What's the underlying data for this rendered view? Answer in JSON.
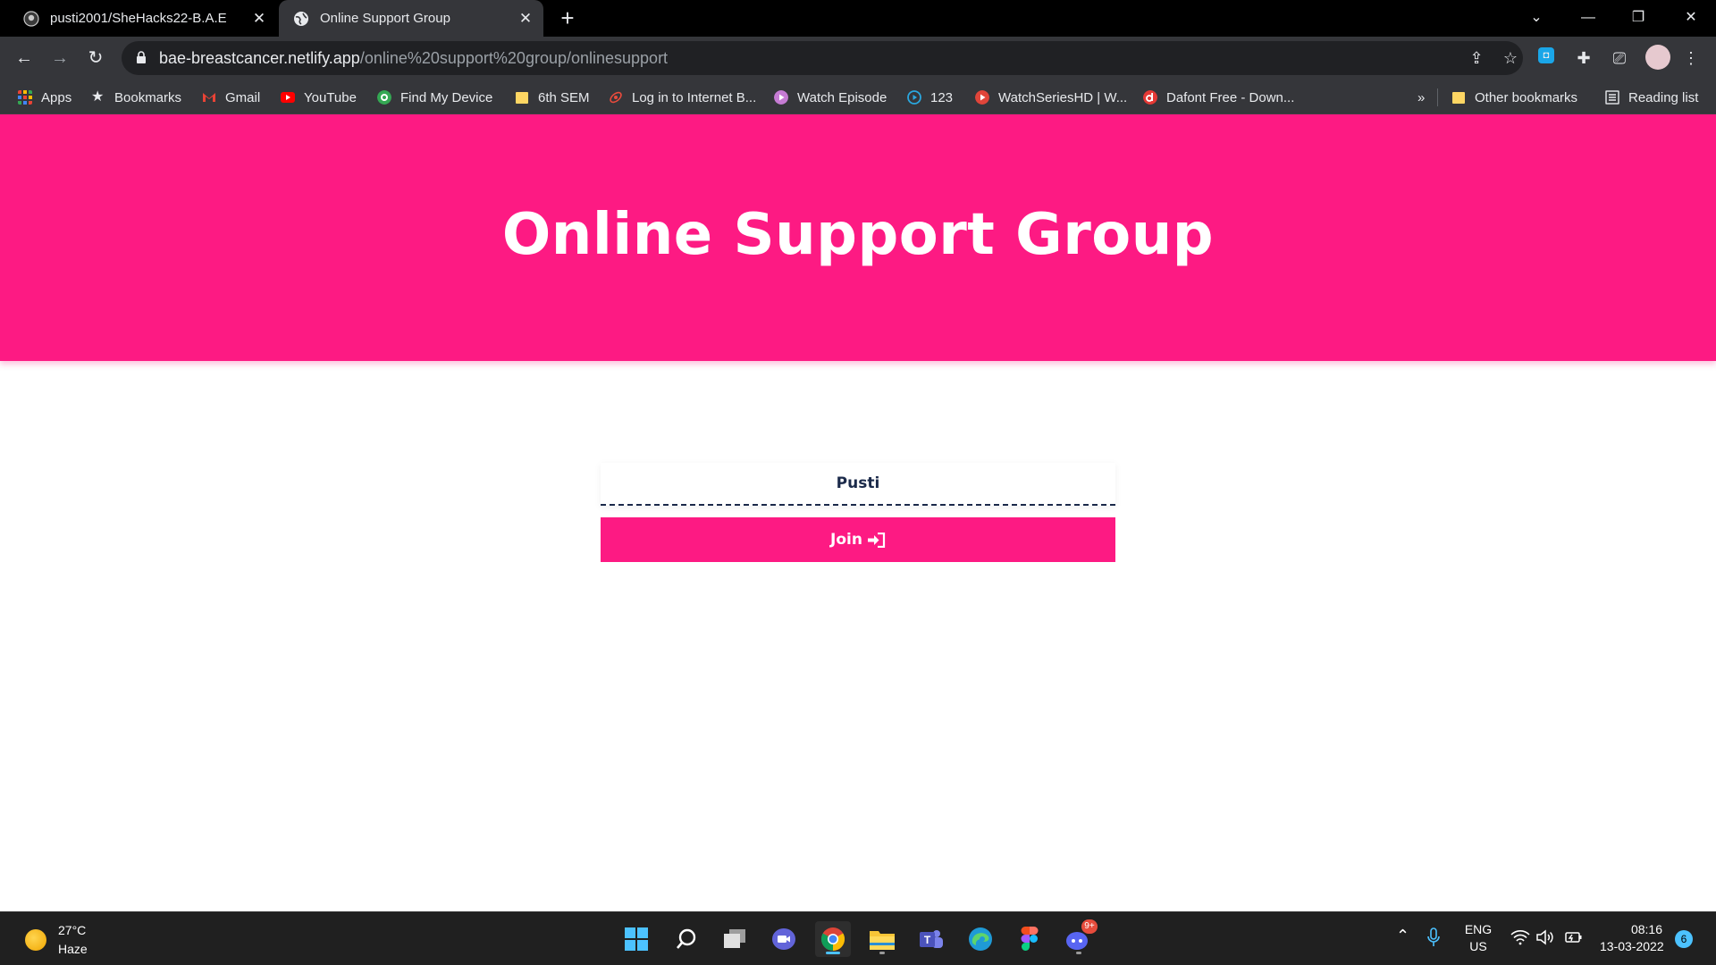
{
  "browser": {
    "tabs": [
      {
        "title": "pusti2001/SheHacks22-B.A.E",
        "icon": "github-icon",
        "active": false
      },
      {
        "title": "Online Support Group",
        "icon": "globe-icon",
        "active": true
      }
    ],
    "url": {
      "host": "bae-breastcancer.netlify.app",
      "path": "/online%20support%20group/onlinesupport"
    },
    "bookmarks": [
      {
        "label": "Apps",
        "icon": "apps-grid-icon"
      },
      {
        "label": "Bookmarks",
        "icon": "star-icon"
      },
      {
        "label": "Gmail",
        "icon": "gmail-icon"
      },
      {
        "label": "YouTube",
        "icon": "youtube-icon"
      },
      {
        "label": "Find My Device",
        "icon": "find-my-device-icon"
      },
      {
        "label": "6th SEM",
        "icon": "folder-icon"
      },
      {
        "label": "Log in to Internet B...",
        "icon": "bank-icon"
      },
      {
        "label": "Watch Episode",
        "icon": "play-icon"
      },
      {
        "label": "123",
        "icon": "play-circle-icon"
      },
      {
        "label": "WatchSeriesHD | W...",
        "icon": "play-icon"
      },
      {
        "label": "Dafont Free - Down...",
        "icon": "dafont-icon"
      }
    ],
    "bookmarks_overflow": "»",
    "other_bookmarks": "Other bookmarks",
    "reading_list": "Reading list"
  },
  "page": {
    "title": "Online Support Group",
    "name_input_value": "Pusti",
    "join_label": "Join",
    "join_icon": "sign-in-icon"
  },
  "taskbar": {
    "weather": {
      "temp": "27°C",
      "desc": "Haze"
    },
    "language": {
      "line1": "ENG",
      "line2": "US"
    },
    "time": "08:16",
    "date": "13-03-2022",
    "notifications": "6",
    "discord_badge": "9+"
  },
  "colors": {
    "brand_pink": "#fd1a83",
    "input_text": "#1b2a4a"
  }
}
